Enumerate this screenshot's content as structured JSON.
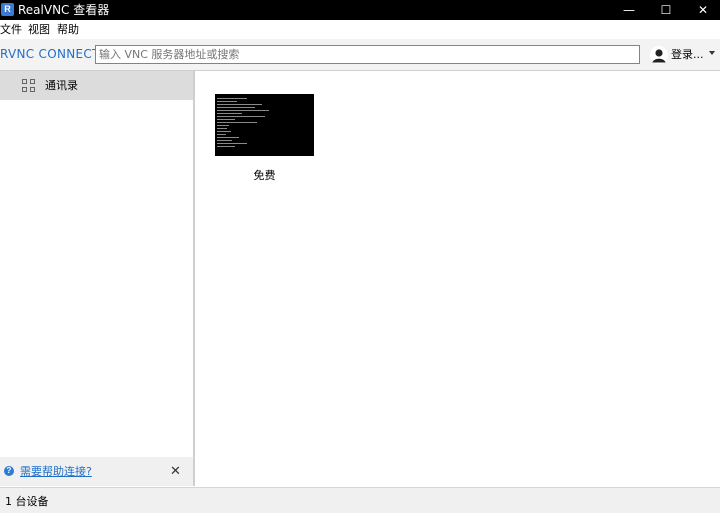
{
  "window": {
    "title": "RealVNC 查看器",
    "icon_letter": "R",
    "controls": [
      "—",
      "☐",
      "✕"
    ]
  },
  "menu": {
    "items": [
      "文件",
      "视图",
      "帮助"
    ]
  },
  "toolbar": {
    "logo": "RVNC CONNECT",
    "search_placeholder": "输入 VNC 服务器地址或搜索",
    "login_label": "登录..."
  },
  "sidebar": {
    "items": [
      {
        "label": "通讯录"
      }
    ],
    "help_link": "需要帮助连接?",
    "help_icon": "?",
    "close": "✕"
  },
  "content": {
    "devices": [
      {
        "label": "免费"
      }
    ]
  },
  "status": {
    "text": "1 台设备"
  },
  "colors": {
    "accent": "#1f6fc7",
    "titlebar": "#000000",
    "selected_item": "#dcdcdc"
  }
}
